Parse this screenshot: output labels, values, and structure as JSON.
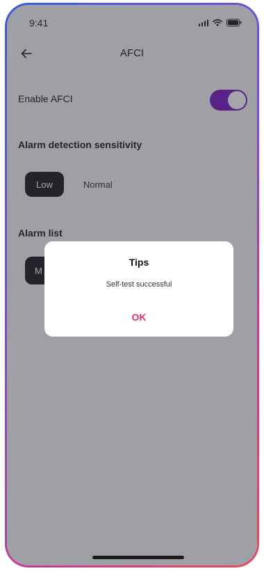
{
  "status_bar": {
    "time": "9:41",
    "icons": [
      "signal-icon",
      "wifi-icon",
      "battery-icon"
    ]
  },
  "nav": {
    "back_icon": "arrow-left-icon",
    "title": "AFCI"
  },
  "settings": {
    "enable_afci_label": "Enable AFCI",
    "enable_afci_on": true,
    "sensitivity_title": "Alarm detection sensitivity",
    "sensitivity_options": [
      "Low",
      "Normal"
    ],
    "sensitivity_selected": "Low",
    "alarm_list_title": "Alarm list",
    "alarm_chip_partial": "M"
  },
  "dialog": {
    "title": "Tips",
    "message": "Self-test successful",
    "ok_label": "OK"
  },
  "colors": {
    "accent": "#e0306a",
    "toggle_on": "#7a1fbf",
    "chip_selected": "#1f1f24"
  }
}
